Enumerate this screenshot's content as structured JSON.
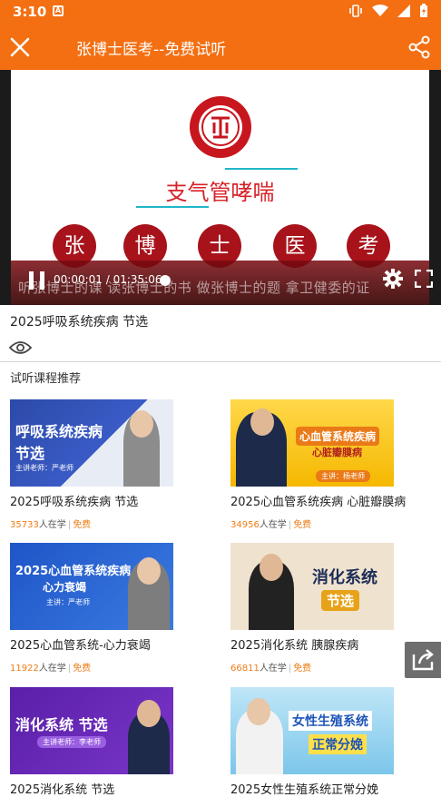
{
  "status": {
    "time": "3:10",
    "notif_icon": "A"
  },
  "app_bar": {
    "title": "张博士医考--免费试听"
  },
  "video": {
    "subject": "支气管哮喘",
    "brand_chars": [
      "张",
      "博",
      "士",
      "医",
      "考"
    ],
    "slogan": "听张博士的课  读张博士的书  做张博士的题  拿卫健委的证",
    "time": "00:00:01 / 01:35:06",
    "colors": {
      "brand_red": "#a8131b",
      "accent_teal": "#21b7c8"
    }
  },
  "course": {
    "title": "2025呼吸系统疾病 节选"
  },
  "section": {
    "title": "试听课程推荐"
  },
  "cards": [
    {
      "name": "2025呼吸系统疾病 节选",
      "count": "35733",
      "count_suffix": "人在学",
      "tag": "免费",
      "thumb": {
        "line1": "呼吸系统疾病",
        "line2": "节选",
        "teacher": "主讲老师：严老师"
      }
    },
    {
      "name": "2025心血管系统疾病 心脏瓣膜病",
      "count": "34956",
      "count_suffix": "人在学",
      "tag": "免费",
      "thumb": {
        "line1": "心血管系统疾病",
        "line2": "心脏瓣膜病",
        "teacher": "主讲：杨老师"
      }
    },
    {
      "name": "2025心血管系统-心力衰竭",
      "count": "11922",
      "count_suffix": "人在学",
      "tag": "免费",
      "thumb": {
        "line1": "2025心血管系统疾病",
        "line2": "心力衰竭",
        "teacher": "主讲：严老师"
      }
    },
    {
      "name": "2025消化系统 胰腺疾病",
      "count": "66811",
      "count_suffix": "人在学",
      "tag": "免费",
      "thumb": {
        "line1": "消化系统",
        "line2": "节选",
        "teacher": ""
      }
    },
    {
      "name": "2025消化系统 节选",
      "count": "",
      "count_suffix": "",
      "tag": "",
      "thumb": {
        "line1": "消化系统 节选",
        "line2": "",
        "teacher": "主讲老师：李老师"
      }
    },
    {
      "name": "2025女性生殖系统正常分娩",
      "count": "",
      "count_suffix": "",
      "tag": "",
      "thumb": {
        "line1": "女性生殖系统",
        "line2": "正常分娩",
        "teacher": ""
      }
    }
  ],
  "icons": [
    "close-icon",
    "share-icon",
    "pause-icon",
    "settings-icon",
    "fullscreen-icon",
    "eye-icon",
    "external-share-icon"
  ]
}
